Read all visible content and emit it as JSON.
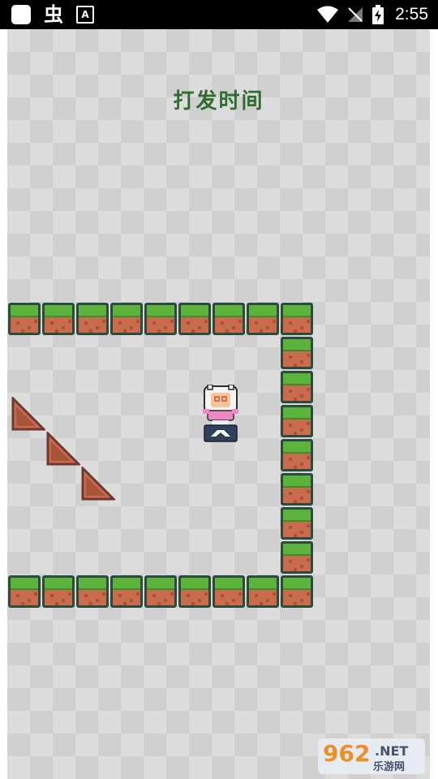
{
  "status_bar": {
    "left_icons": [
      "app-square-icon",
      "bug-icon",
      "a-badge-icon"
    ],
    "bug_glyph": "虫",
    "a_badge": "A",
    "right_icons": [
      "wifi-icon",
      "no-signal-icon",
      "battery-charging-icon"
    ],
    "time": "2:55"
  },
  "game": {
    "title": "打发时间",
    "tile_type": "grass-dirt-block",
    "ramp_count": 3,
    "character": "white-hood-pink-hero"
  },
  "watermark": {
    "number": "962",
    "domain": ".NET",
    "chinese": "乐游网"
  },
  "colors": {
    "title_green": "#2f6e2e",
    "grass": "#5bb33b",
    "dirt": "#c96b4c",
    "tile_border": "#2d4a3e",
    "background_light": "#dcdcdc",
    "background_dark": "#d0d0d0"
  }
}
